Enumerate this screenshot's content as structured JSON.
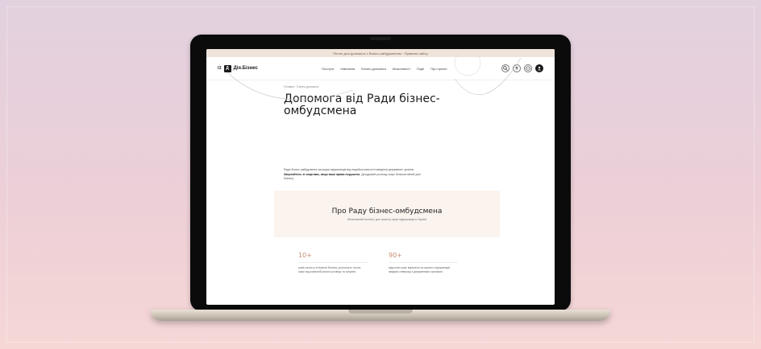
{
  "site": {
    "announcement": "Регіон для допомоги з бізнес-омбудсменом · Правила сайту",
    "logo": {
      "prefix": "IЗ",
      "mark": "Д",
      "name": "Дія.Бізнес"
    },
    "nav_links": [
      "Послуги",
      "Навчання",
      "Бізнес-допомога",
      "Можливості",
      "Події",
      "Про проєкт"
    ],
    "nav_icons": [
      "search-icon",
      "accessibility-icon",
      "language-icon",
      "user-icon"
    ],
    "breadcrumb": "Головна · Бізнес-допомога",
    "hero_title": "Допомога від Ради бізнес-омбудсмена",
    "intro_lead": "Рада бізнес-омбудсмена захищає підприємців від недобросовісної поведінки державних органів.",
    "intro_bold": "Звертайтесь зі скаргами, якщо ваші права порушено.",
    "intro_rest": "Досудовий розгляд скарг безкоштовний для бізнесу.",
    "about_title": "Про Раду бізнес-омбудсмена",
    "about_subtitle": "Незалежний інститут для захисту прав підприємців в Україні",
    "stats": [
      {
        "num": "10+",
        "text": "років захисту інтересів бізнесу, розглянуто тисячі скарг від компаній різного розміру та галузей."
      },
      {
        "num": "90+",
        "text": "відсотків скарг вирішено на користь підприємців завдяки співпраці з державними органами."
      }
    ]
  }
}
